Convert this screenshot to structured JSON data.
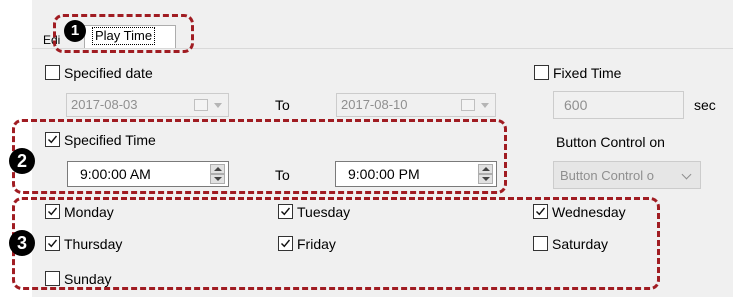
{
  "tabs": [
    {
      "label": "Edi"
    },
    {
      "label": "Play Time",
      "active": true
    }
  ],
  "specified_date": {
    "label": "Specified date",
    "checked": false,
    "from": "2017-08-03",
    "to_label": "To",
    "to": "2017-08-10"
  },
  "fixed_time": {
    "label": "Fixed Time",
    "checked": false,
    "value": "600",
    "unit": "sec"
  },
  "specified_time": {
    "label": "Specified Time",
    "checked": true,
    "from": "9:00:00 AM",
    "to_label": "To",
    "to": "9:00:00 PM"
  },
  "button_control": {
    "label": "Button Control on",
    "select_value": "Button Control o"
  },
  "days": [
    {
      "label": "Monday",
      "checked": true
    },
    {
      "label": "Tuesday",
      "checked": true
    },
    {
      "label": "Wednesday",
      "checked": true
    },
    {
      "label": "Thursday",
      "checked": true
    },
    {
      "label": "Friday",
      "checked": true
    },
    {
      "label": "Saturday",
      "checked": false
    },
    {
      "label": "Sunday",
      "checked": false
    }
  ],
  "callouts": [
    "1",
    "2",
    "3"
  ],
  "colors": {
    "highlight": "#a01c22",
    "panel": "#f0f0f0"
  }
}
